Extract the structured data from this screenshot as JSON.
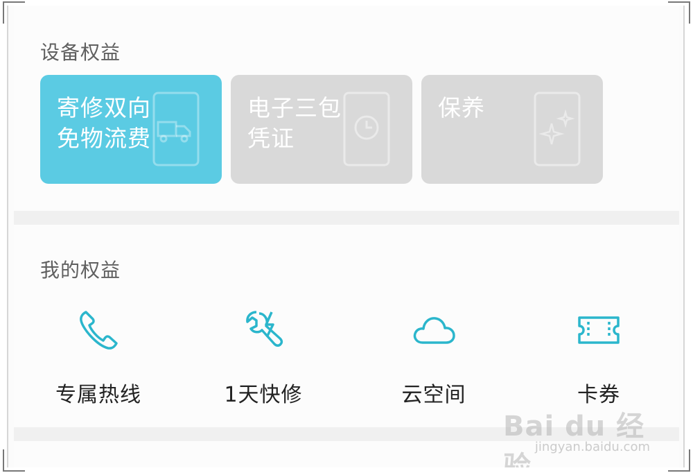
{
  "device_benefits": {
    "title": "设备权益",
    "cards": [
      {
        "label": "寄修双向免物流费",
        "active": true
      },
      {
        "label": "电子三包凭证",
        "active": false
      },
      {
        "label": "保养",
        "active": false
      }
    ]
  },
  "my_benefits": {
    "title": "我的权益",
    "items": [
      {
        "label": "专属热线",
        "icon": "phone-icon"
      },
      {
        "label": "1天快修",
        "icon": "repair-tools-icon"
      },
      {
        "label": "云空间",
        "icon": "cloud-icon"
      },
      {
        "label": "卡券",
        "icon": "ticket-icon"
      }
    ]
  },
  "watermark": {
    "logo": "Bai du 经验",
    "url": "jingyan.baidu.com"
  },
  "colors": {
    "accent": "#5bcbe3",
    "icon": "#2bb6cc",
    "card_inactive": "#d9d9d9"
  }
}
